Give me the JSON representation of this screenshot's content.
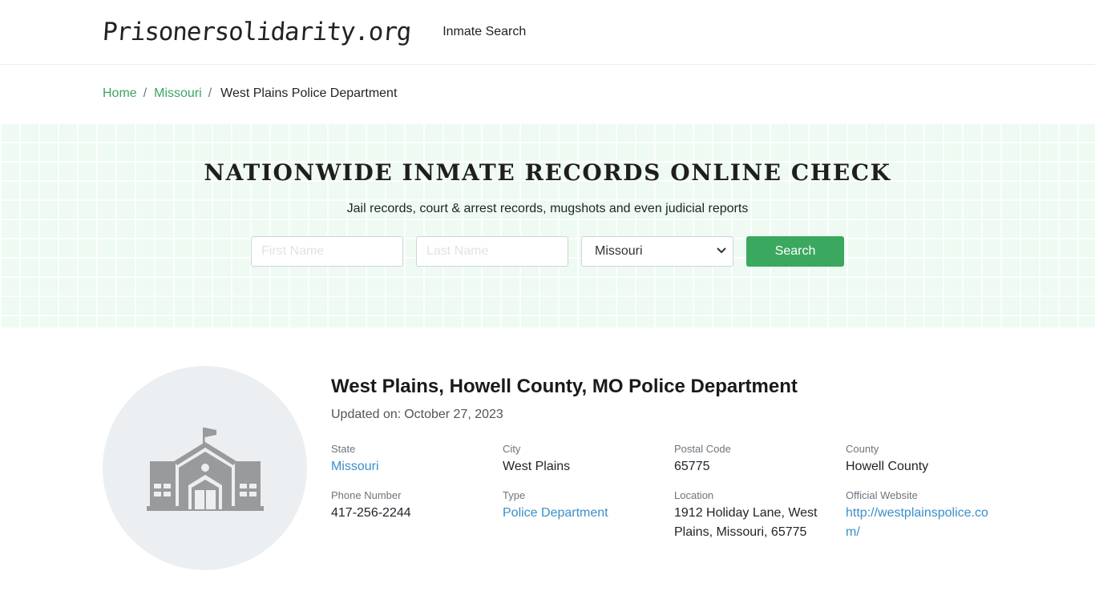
{
  "header": {
    "logo": "Prisonersolidarity.org",
    "nav_inmate_search": "Inmate Search"
  },
  "breadcrumb": {
    "home": "Home",
    "separator": "/",
    "state": "Missouri",
    "current": "West Plains Police Department"
  },
  "hero": {
    "title": "NATIONWIDE INMATE RECORDS ONLINE CHECK",
    "subtitle": "Jail records, court & arrest records, mugshots and even judicial reports",
    "first_name_placeholder": "First Name",
    "last_name_placeholder": "Last Name",
    "state_selected": "Missouri",
    "search_label": "Search"
  },
  "detail": {
    "title": "West Plains, Howell County, MO Police Department",
    "updated_label": "Updated on:",
    "updated_date": "October 27, 2023",
    "fields": {
      "state_label": "State",
      "state_value": "Missouri",
      "city_label": "City",
      "city_value": "West Plains",
      "postal_label": "Postal Code",
      "postal_value": "65775",
      "county_label": "County",
      "county_value": "Howell County",
      "phone_label": "Phone Number",
      "phone_value": "417-256-2244",
      "type_label": "Type",
      "type_value": "Police Department",
      "location_label": "Location",
      "location_value": "1912 Holiday Lane, West Plains, Missouri, 65775",
      "website_label": "Official Website",
      "website_value": "http://westplainspolice.com/"
    },
    "icon": "government-building-icon"
  },
  "colors": {
    "accent_green": "#3aa85f",
    "link_blue": "#3a8fc9",
    "hero_bg": "#eefaf2"
  }
}
